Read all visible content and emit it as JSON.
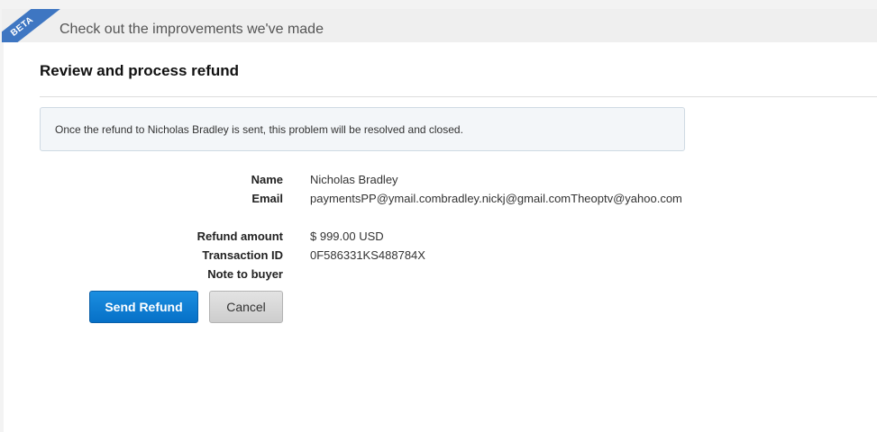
{
  "banner": {
    "badge": "BETA",
    "text": "Check out the improvements we've made"
  },
  "page": {
    "title": "Review and process refund",
    "notice": "Once the refund to Nicholas Bradley is sent, this problem will be resolved and closed."
  },
  "details": {
    "name_label": "Name",
    "name_value": "Nicholas Bradley",
    "email_label": "Email",
    "email_value": "paymentsPP@ymail.combradley.nickj@gmail.comTheoptv@yahoo.com",
    "amount_label": "Refund amount",
    "amount_value": "$ 999.00 USD",
    "txn_label": "Transaction ID",
    "txn_value": "0F586331KS488784X",
    "note_label": "Note to buyer",
    "note_value": ""
  },
  "actions": {
    "send_label": "Send Refund",
    "cancel_label": "Cancel"
  },
  "colors": {
    "beta_ribbon": "#3e76c2",
    "primary_button": "#0670c7",
    "notice_bg": "#f3f6f9"
  }
}
